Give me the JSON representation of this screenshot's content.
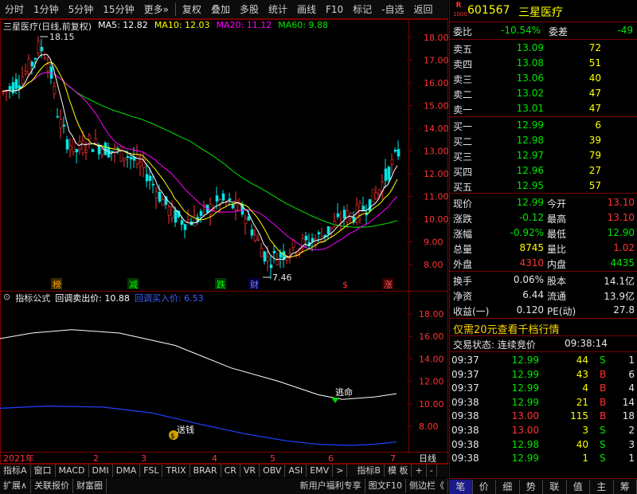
{
  "toolbar": {
    "items": [
      "分时",
      "1分钟",
      "5分钟",
      "15分钟",
      "更多»",
      "复权",
      "叠加",
      "多股",
      "统计",
      "画线",
      "F10",
      "标记",
      "-自选",
      "返回"
    ]
  },
  "main_chart": {
    "title": "三星医疗(日线,前复权)",
    "ma5": "MA5: 12.82",
    "ma10": "MA10: 12.03",
    "ma20": "MA20: 11.12",
    "ma60": "MA60: 9.88",
    "high_label": "18.15",
    "low_label": "7.46",
    "price_ticks": [
      "18.00",
      "17.00",
      "16.00",
      "15.00",
      "14.00",
      "13.00",
      "12.00",
      "11.00",
      "10.00",
      "9.00",
      "8.00"
    ],
    "markers": [
      "榜",
      "减",
      "跌",
      "财",
      "$",
      "涨"
    ]
  },
  "indicator": {
    "name": "指标公式",
    "line1": "回调卖出价: 10.88",
    "line2": "回调买入价: 6.53",
    "ticks": [
      "18.00",
      "16.00",
      "14.00",
      "12.00",
      "10.00",
      "8.00"
    ],
    "sell_label": "逃命",
    "buy_label": "送钱"
  },
  "time_axis": {
    "labels": [
      "2021年",
      "2",
      "3",
      "4",
      "5",
      "6",
      "7"
    ],
    "period": "日线"
  },
  "tabs1": [
    "指标A",
    "窗口",
    "MACD",
    "DMI",
    "DMA",
    "FSL",
    "TRIX",
    "BRAR",
    "CR",
    "VR",
    "OBV",
    "ASI",
    "EMV",
    ">",
    "指标B",
    "模 板",
    "+",
    "-"
  ],
  "tabs2": {
    "left": [
      "扩展∧",
      "关联报价",
      "财富圈"
    ],
    "right": [
      "新用户福利专享",
      "图文F10",
      "侧边栏《"
    ]
  },
  "stock": {
    "badge_r": "R",
    "badge_num": "1000",
    "code": "601567",
    "name": "三星医疗"
  },
  "committee": {
    "ratio_label": "委比",
    "ratio_value": "-10.54%",
    "diff_label": "委差",
    "diff_value": "-49"
  },
  "asks": [
    {
      "label": "卖五",
      "price": "13.09",
      "vol": "72"
    },
    {
      "label": "卖四",
      "price": "13.08",
      "vol": "51"
    },
    {
      "label": "卖三",
      "price": "13.06",
      "vol": "40"
    },
    {
      "label": "卖二",
      "price": "13.02",
      "vol": "47"
    },
    {
      "label": "卖一",
      "price": "13.01",
      "vol": "47"
    }
  ],
  "bids": [
    {
      "label": "买一",
      "price": "12.99",
      "vol": "6"
    },
    {
      "label": "买二",
      "price": "12.98",
      "vol": "39"
    },
    {
      "label": "买三",
      "price": "12.97",
      "vol": "79"
    },
    {
      "label": "买四",
      "price": "12.96",
      "vol": "27"
    },
    {
      "label": "买五",
      "price": "12.95",
      "vol": "57"
    }
  ],
  "quote": {
    "xianjia_label": "现价",
    "xianjia": "12.99",
    "jinkai_label": "今开",
    "jinkai": "13.10",
    "zhangdie_label": "涨跌",
    "zhangdie": "-0.12",
    "zuigao_label": "最高",
    "zuigao": "13.10",
    "zhangfu_label": "涨幅",
    "zhangfu": "-0.92%",
    "zuidi_label": "最低",
    "zuidi": "12.90",
    "zongliang_label": "总量",
    "zongliang": "8745",
    "liangbi_label": "量比",
    "liangbi": "1.02",
    "waipan_label": "外盘",
    "waipan": "4310",
    "neipan_label": "内盘",
    "neipan": "4435"
  },
  "fundamentals": {
    "huanshou_label": "换手",
    "huanshou": "0.06%",
    "guben_label": "股本",
    "guben": "14.1亿",
    "jingzi_label": "净资",
    "jingzi": "6.44",
    "liutong_label": "流通",
    "liutong": "13.9亿",
    "shouyi_label": "收益(一)",
    "shouyi": "0.120",
    "pe_label": "PE(动)",
    "pe": "27.8"
  },
  "promo": "仅需20元查看千档行情",
  "trade_status": {
    "label": "交易状态: 连续竞价",
    "time": "09:38:14"
  },
  "ticks": [
    {
      "time": "09:37",
      "price": "12.99",
      "vol": "44",
      "side": "S",
      "num": "1"
    },
    {
      "time": "09:37",
      "price": "12.99",
      "vol": "43",
      "side": "B",
      "num": "6"
    },
    {
      "time": "09:37",
      "price": "12.99",
      "vol": "4",
      "side": "B",
      "num": "4"
    },
    {
      "time": "09:38",
      "price": "12.99",
      "vol": "21",
      "side": "B",
      "num": "14"
    },
    {
      "time": "09:38",
      "price": "13.00",
      "vol": "115",
      "side": "B",
      "num": "18"
    },
    {
      "time": "09:38",
      "price": "13.00",
      "vol": "3",
      "side": "S",
      "num": "2"
    },
    {
      "time": "09:38",
      "price": "12.98",
      "vol": "40",
      "side": "S",
      "num": "3"
    },
    {
      "time": "09:38",
      "price": "12.99",
      "vol": "1",
      "side": "S",
      "num": "1"
    }
  ],
  "bottom_right_tabs": [
    "笔",
    "价",
    "细",
    "势",
    "联",
    "值",
    "主",
    "筹"
  ],
  "colors": {
    "up": "#ff3232",
    "down": "#00e600",
    "ma5": "#ffffff",
    "ma10": "#ffff00",
    "ma20": "#ff00ff",
    "ma60": "#00e600",
    "frame": "#800000"
  }
}
